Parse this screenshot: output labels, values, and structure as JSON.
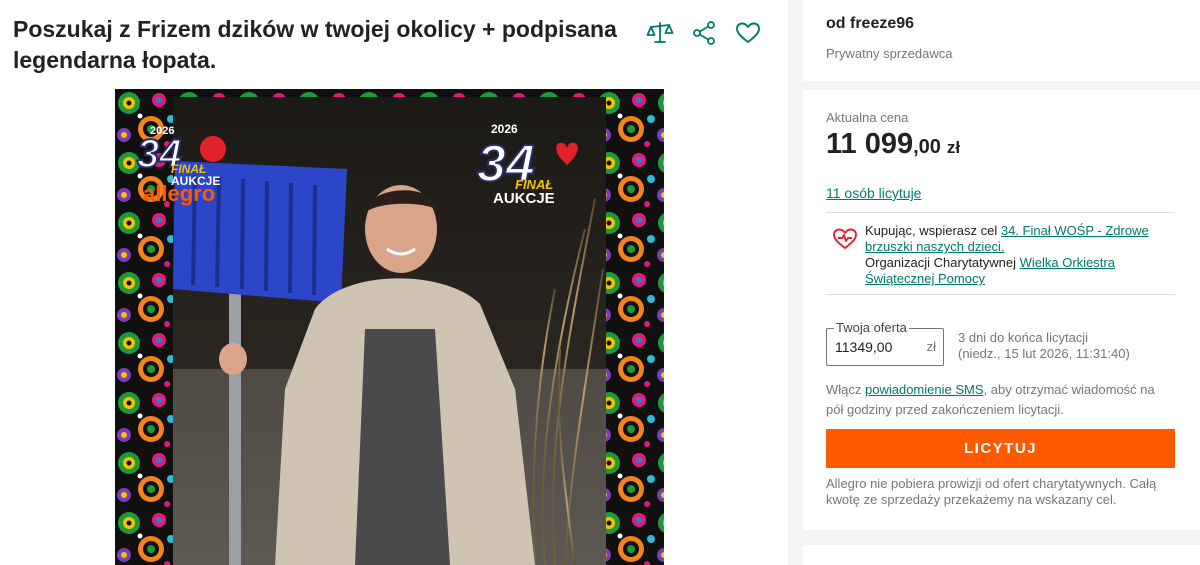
{
  "listing": {
    "title": "Poszukaj z Frizem dzików w twojej okolicy + podpisana legendarna łopata."
  },
  "actions": {
    "compare_icon": "scale-icon",
    "share_icon": "share-icon",
    "favorite_icon": "heart-icon"
  },
  "photo": {
    "badge_left": {
      "year": "2026",
      "number": "34",
      "line1": "FINAŁ",
      "line2": "AUKCJE",
      "brand": "allegro"
    },
    "badge_right": {
      "year": "2026",
      "number": "34",
      "line1": "FINAŁ",
      "line2": "AUKCJE"
    }
  },
  "seller": {
    "name": "od freeze96",
    "type": "Prywatny sprzedawca"
  },
  "price": {
    "label": "Aktualna cena",
    "whole": "11 099",
    "decimal": ",00",
    "currency": "zł"
  },
  "bidders": {
    "link": "11 osób licytuje"
  },
  "charity": {
    "prefix": "Kupując, wspierasz cel ",
    "goal_link": "34. Finał WOŚP - Zdrowe brzuszki naszych dzieci.",
    "org_prefix": "Organizacji Charytatywnej ",
    "org_link": "Wielka Orkiestra Świątecznej Pomocy"
  },
  "offer": {
    "label": "Twoja oferta",
    "value": "11349,00",
    "currency": "zł"
  },
  "auction_end": {
    "remaining": "3 dni do końca licytacji",
    "date": "(niedz., 15 lut 2026, 11:31:40)"
  },
  "sms": {
    "prefix": "Włącz ",
    "link": "powiadomienie SMS",
    "suffix": ", aby otrzymać wiadomość na pół godziny przed zakończeniem licytacji."
  },
  "bid_button": {
    "label": "LICYTUJ"
  },
  "commission_note": "Allegro nie pobiera prowizji od ofert charytatywnych. Całą kwotę ze sprzedaży przekażemy na wskazany cel.",
  "colors": {
    "accent_orange": "#ff5a00",
    "link_teal": "#00796b",
    "wosp_red": "#e2212b"
  }
}
